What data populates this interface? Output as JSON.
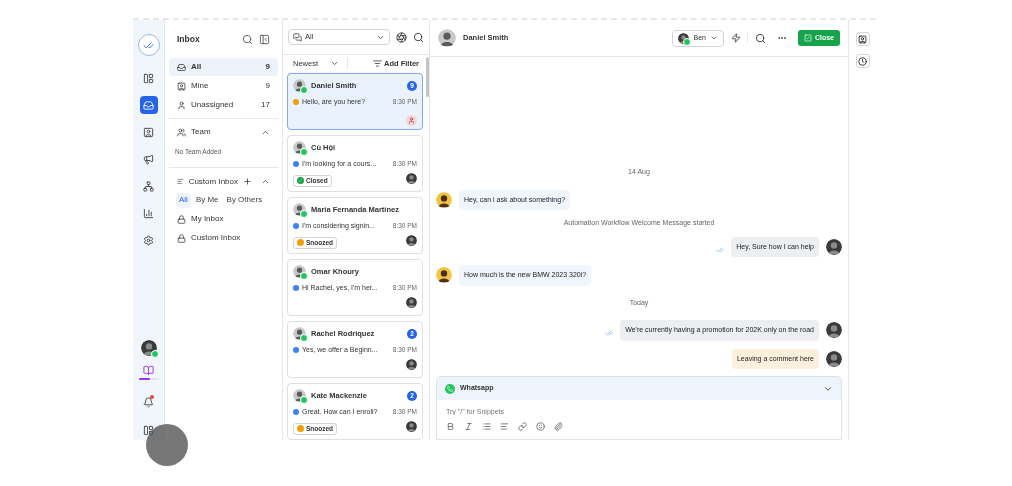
{
  "rail": {
    "top": [
      {
        "kind": "logo",
        "selected": false
      },
      {
        "kind": "layout",
        "selected": false
      },
      {
        "kind": "inbox",
        "selected": true
      },
      {
        "kind": "contact",
        "selected": false
      },
      {
        "kind": "megaphone",
        "selected": false
      },
      {
        "kind": "network",
        "selected": false
      },
      {
        "kind": "chart",
        "selected": false
      },
      {
        "kind": "settings",
        "selected": false
      }
    ],
    "user": {
      "online": true
    },
    "guide": {
      "level": 0.55
    },
    "notifications": {
      "unread": true
    }
  },
  "inbox": {
    "title": "Inbox",
    "items": [
      {
        "label": "All",
        "count": "9",
        "selected": true
      },
      {
        "label": "Mine",
        "count": "9",
        "selected": false
      },
      {
        "label": "Unassigned",
        "count": "17",
        "selected": false
      }
    ],
    "team": {
      "label": "Team",
      "expanded": true,
      "empty": "No Team Added"
    },
    "custom": {
      "label": "Custom Inbox",
      "expanded": true,
      "tabs": [
        {
          "label": "All",
          "selected": true
        },
        {
          "label": "By Me",
          "selected": false
        },
        {
          "label": "By Others",
          "selected": false
        }
      ],
      "items": [
        "My Inbox",
        "Custom Inbox"
      ]
    }
  },
  "list": {
    "filter": "All",
    "sort": "Newest",
    "add_filter": "Add Filter",
    "conversations": [
      {
        "name": "Daniel Smith",
        "preview": "Hello, are you here?",
        "time": "8:30 PM",
        "unread": "9",
        "color": "#f59e0b",
        "assigned": false,
        "selected": true
      },
      {
        "name": "Cù Hội",
        "preview": "I'm looking for a cours...",
        "time": "8:30 PM",
        "color": "#3b82f6",
        "status": {
          "kind": "closed",
          "label": "Closed"
        },
        "assigned": true,
        "selected": false
      },
      {
        "name": "Maria Fernanda Martínez",
        "preview": "I'm considering signin...",
        "time": "8:30 PM",
        "color": "#3b82f6",
        "status": {
          "kind": "snoozed",
          "label": "Snoozed"
        },
        "assigned": true,
        "selected": false
      },
      {
        "name": "Omar Khoury",
        "preview": "Hi Rachel, yes, I'm her...",
        "time": "8:30 PM",
        "color": "#3b82f6",
        "assigned": true,
        "selected": false
      },
      {
        "name": "Rachel Rodriquez",
        "preview": "Yes, we offer a Beginn...",
        "time": "8:30 PM",
        "unread": "2",
        "color": "#3b82f6",
        "assigned": true,
        "selected": false
      },
      {
        "name": "Kate Mackenzie",
        "preview": "Great. How can I enroll?",
        "time": "8:30 PM",
        "unread": "2",
        "color": "#3b82f6",
        "status": {
          "kind": "snoozed",
          "label": "Snoozed"
        },
        "assigned": true,
        "selected": false
      }
    ]
  },
  "chat": {
    "contact": "Daniel Smith",
    "assignee": "Ben",
    "assignee_online": true,
    "close": "Close",
    "messages": [
      {
        "kind": "date",
        "text": "14 Aug"
      },
      {
        "kind": "incoming",
        "text": "Hey, can i ask about something?"
      },
      {
        "kind": "system",
        "text": "Automation Workflow Welcome Message started"
      },
      {
        "kind": "outgoing",
        "text": "Hey, Sure how I can help"
      },
      {
        "kind": "incoming",
        "text": "How much is the new BMW 2023 320i?"
      },
      {
        "kind": "date",
        "text": "Today"
      },
      {
        "kind": "outgoing",
        "text": "We're currently having a promotion for 202K only on the road"
      },
      {
        "kind": "note",
        "text": "Leaving a comment here"
      }
    ],
    "composer": {
      "channel": "Whatsapp",
      "placeholder": "Try \"/\" for Snippets"
    }
  }
}
